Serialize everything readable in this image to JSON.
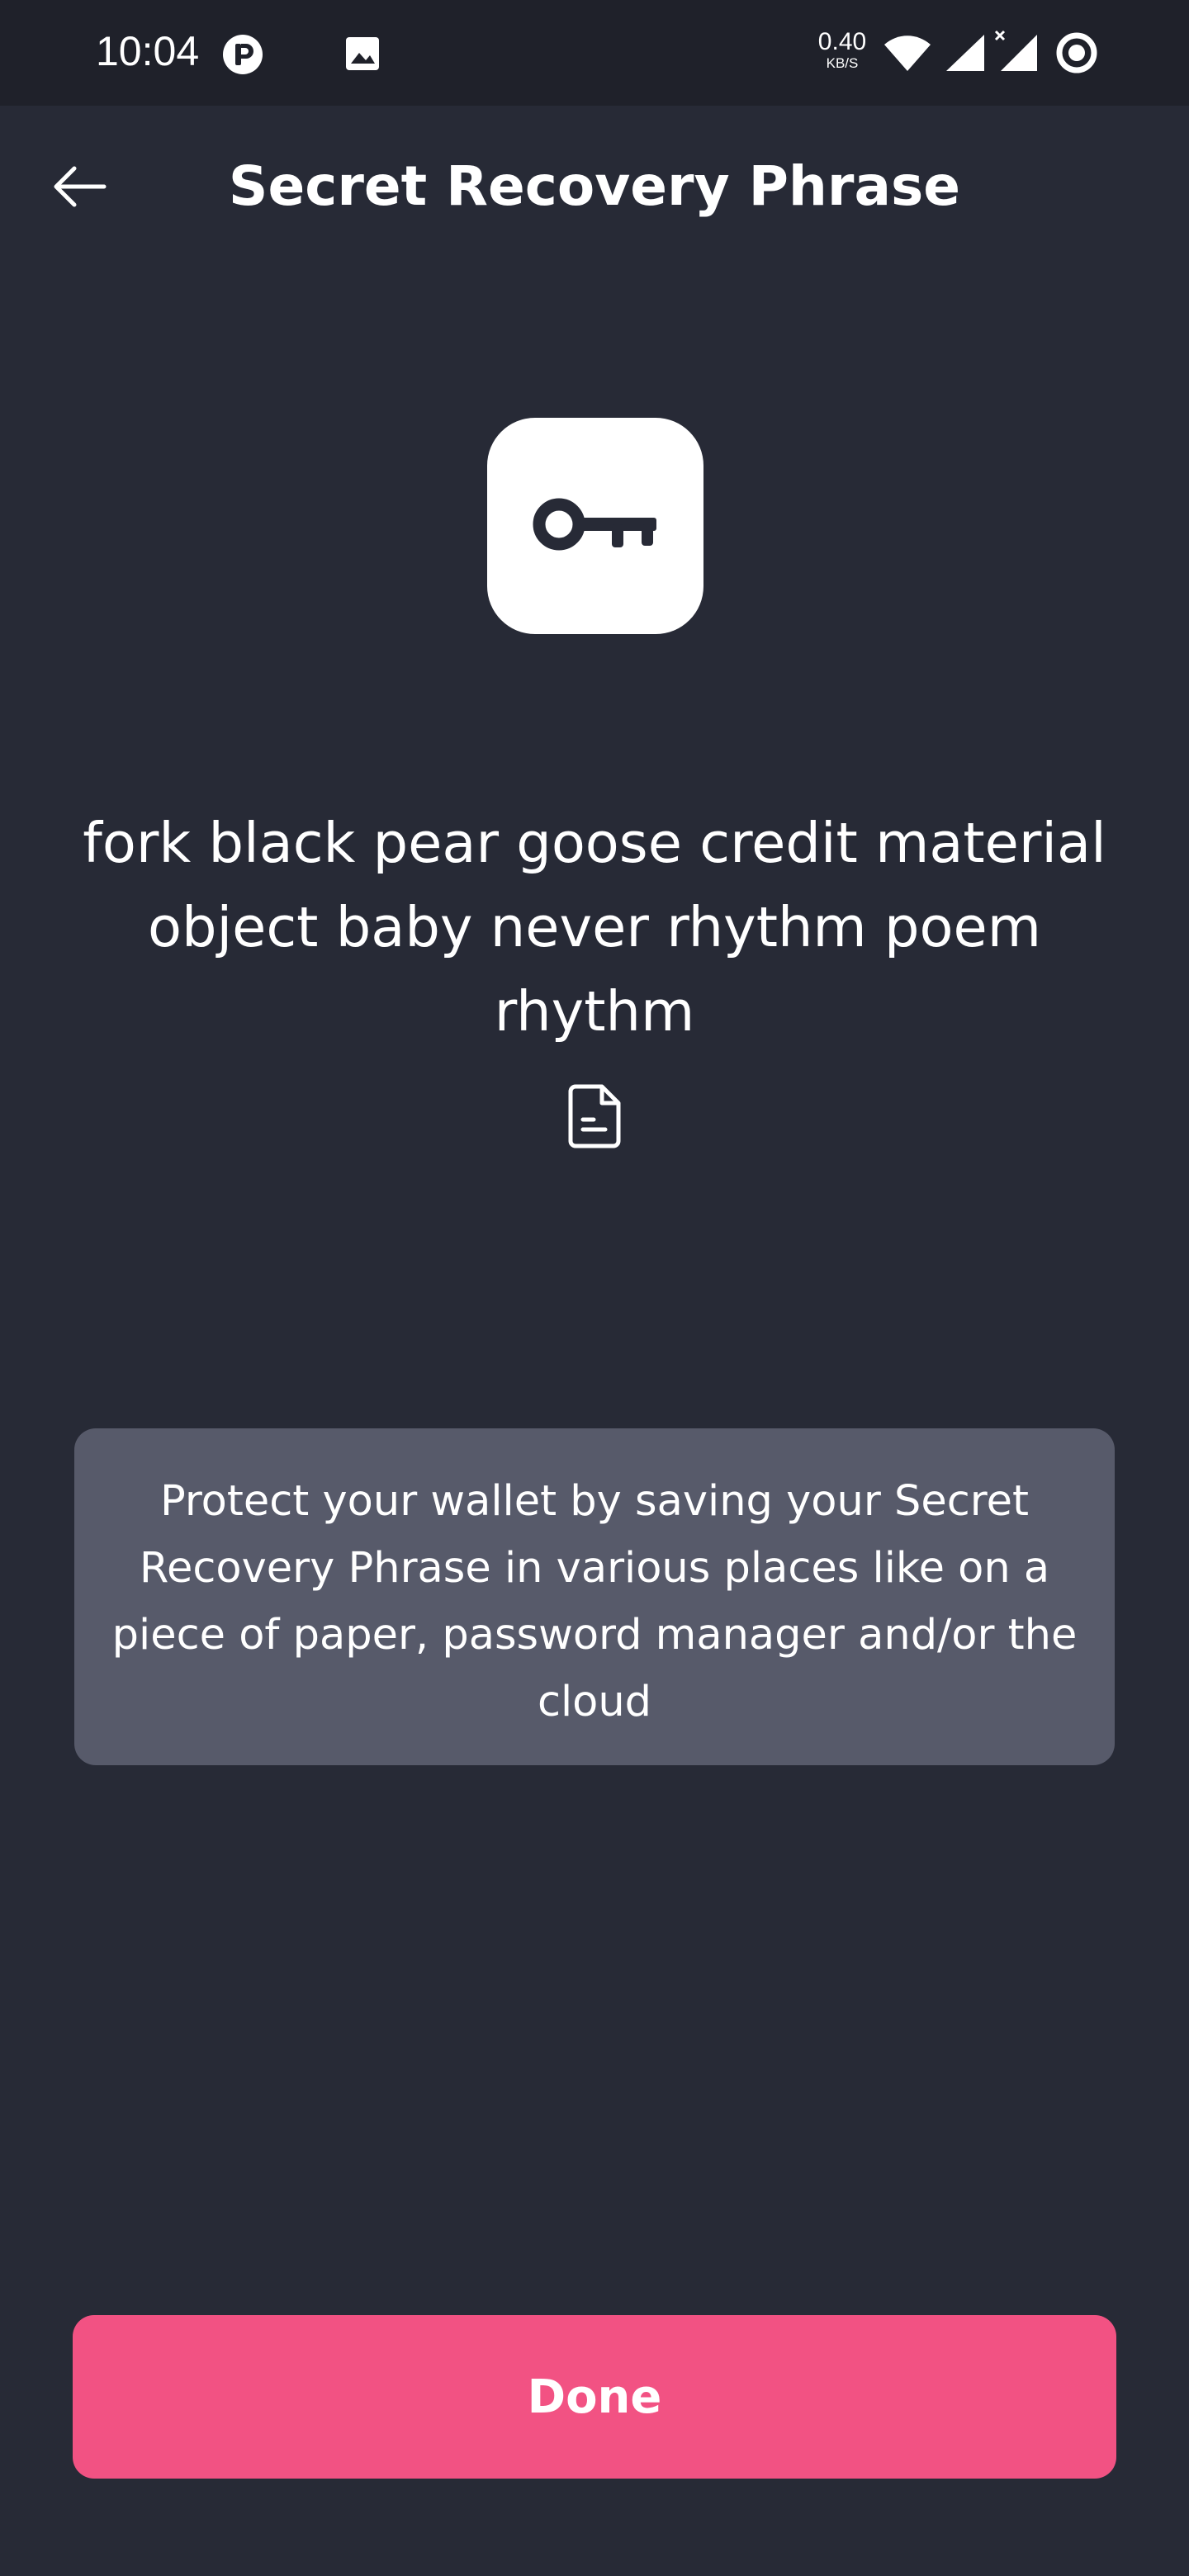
{
  "status_bar": {
    "time": "10:04",
    "net_speed_value": "0.40",
    "net_speed_unit": "KB/S",
    "icons": [
      "app-notification-icon",
      "image-notification-icon",
      "wifi-icon",
      "signal-icon",
      "signal-x-icon",
      "record-icon"
    ]
  },
  "header": {
    "title": "Secret Recovery Phrase",
    "back_icon": "arrow-left-icon"
  },
  "key_icon": "key-icon",
  "phrase": {
    "text": "fork black pear goose credit material object baby never rhythm poem rhythm",
    "copy_icon": "document-icon"
  },
  "info": {
    "text": "Protect your wallet by saving your Secret Recovery Phrase in various places like on a piece of paper, password manager and/or the cloud"
  },
  "done_button": {
    "label": "Done"
  },
  "colors": {
    "background": "#272a36",
    "status_bar": "#1f212a",
    "info_box": "#575a6a",
    "accent": "#f25283",
    "text": "#ffffff"
  }
}
